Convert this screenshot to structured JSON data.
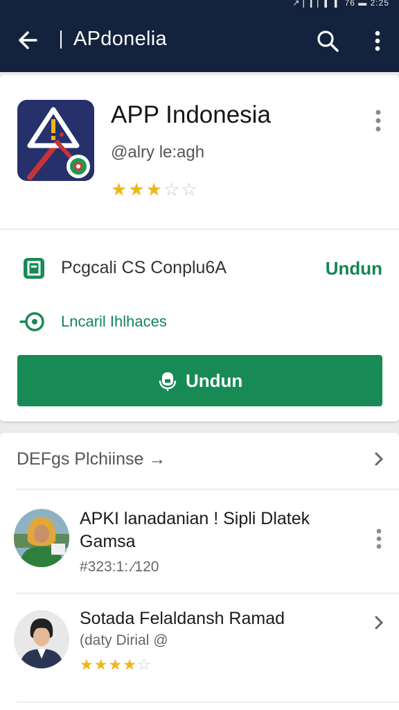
{
  "status_bar": {
    "text": "↗ ▏▎▏▍ ▍ 76 ▬ 2:25"
  },
  "app_bar": {
    "title": "APdonelia"
  },
  "app": {
    "name": "APP Indonesia",
    "developer": "@alry le:agh",
    "rating_stars": 3,
    "rating_max": 5
  },
  "info_row": {
    "label": "Pcgcali CS Conplu6A",
    "action": "Undun"
  },
  "link_row": {
    "label": "Lncaril Ihlhaces"
  },
  "install_button": {
    "label": "Undun"
  },
  "section": {
    "title": "DEFgs Plchiinse →",
    "items": [
      {
        "title": "APKI lanadanian ! Sipli Dlatek Gamsa",
        "subtitle": "#323:1:.⁄120"
      },
      {
        "title": "Sotada Felaldansh Ramad",
        "subtitle": "(daty Dirial @",
        "rating_stars": 4,
        "rating_max": 5
      }
    ]
  },
  "colors": {
    "app_bar": "#14233d",
    "accent_green": "#178a56",
    "star": "#f2b417"
  }
}
